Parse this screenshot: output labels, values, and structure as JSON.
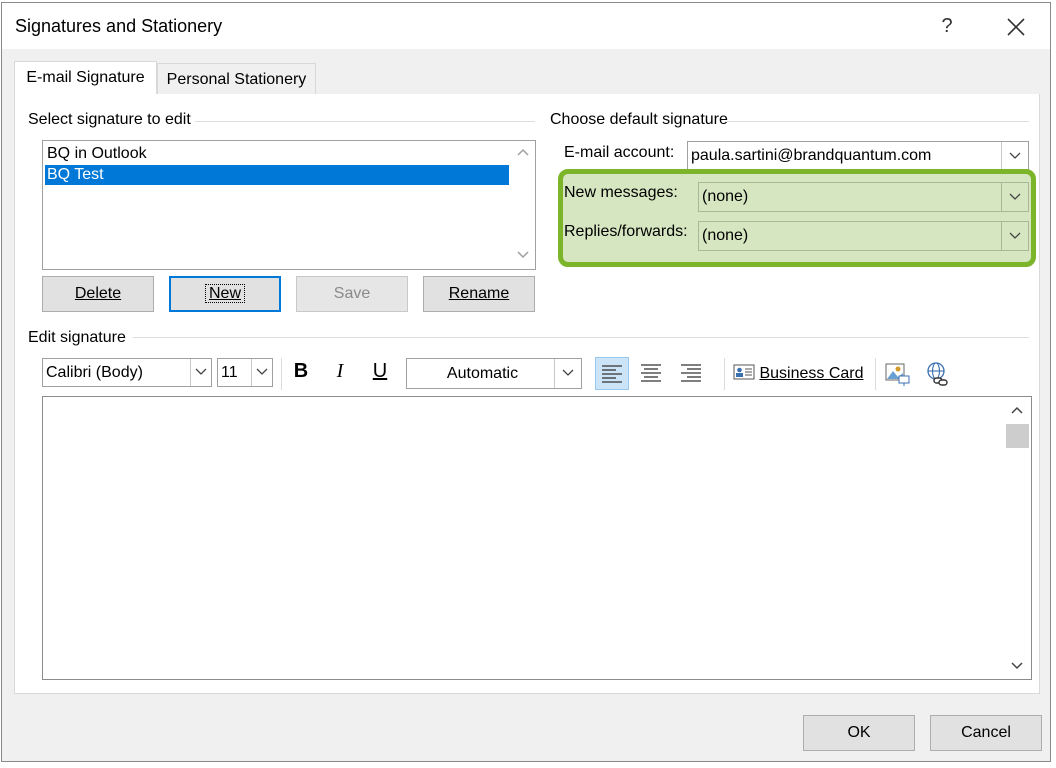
{
  "window": {
    "title": "Signatures and Stationery",
    "help_label": "?",
    "close_label": "✕"
  },
  "tabs": [
    {
      "label": "E-mail Signature",
      "active": true
    },
    {
      "label": "Personal Stationery",
      "active": false
    }
  ],
  "select_signature": {
    "group_label": "Select signature to edit",
    "items": [
      "BQ in Outlook",
      "BQ Test"
    ],
    "selected_index": 1,
    "buttons": {
      "delete": "Delete",
      "new": "New",
      "save": "Save",
      "rename": "Rename"
    }
  },
  "default_signature": {
    "group_label": "Choose default signature",
    "email_account_label": "E-mail account:",
    "email_account_value": "paula.sartini@brandquantum.com",
    "new_messages_label": "New messages:",
    "new_messages_value": "(none)",
    "replies_label": "Replies/forwards:",
    "replies_value": "(none)",
    "highlight_color": "#7cb52a"
  },
  "edit_signature": {
    "group_label": "Edit signature",
    "font_value": "Calibri (Body)",
    "size_value": "11",
    "bold_label": "B",
    "italic_label": "I",
    "underline_label": "U",
    "color_value": "Automatic",
    "business_card_label": "Business Card",
    "icons": [
      "align-left-icon",
      "align-center-icon",
      "align-right-icon",
      "business-card-icon",
      "insert-picture-icon",
      "insert-hyperlink-icon"
    ]
  },
  "footer": {
    "ok_label": "OK",
    "cancel_label": "Cancel"
  },
  "colors": {
    "selection": "#0078d7",
    "dialog_bg": "#f0f0f0",
    "highlight": "#7cb52a"
  }
}
